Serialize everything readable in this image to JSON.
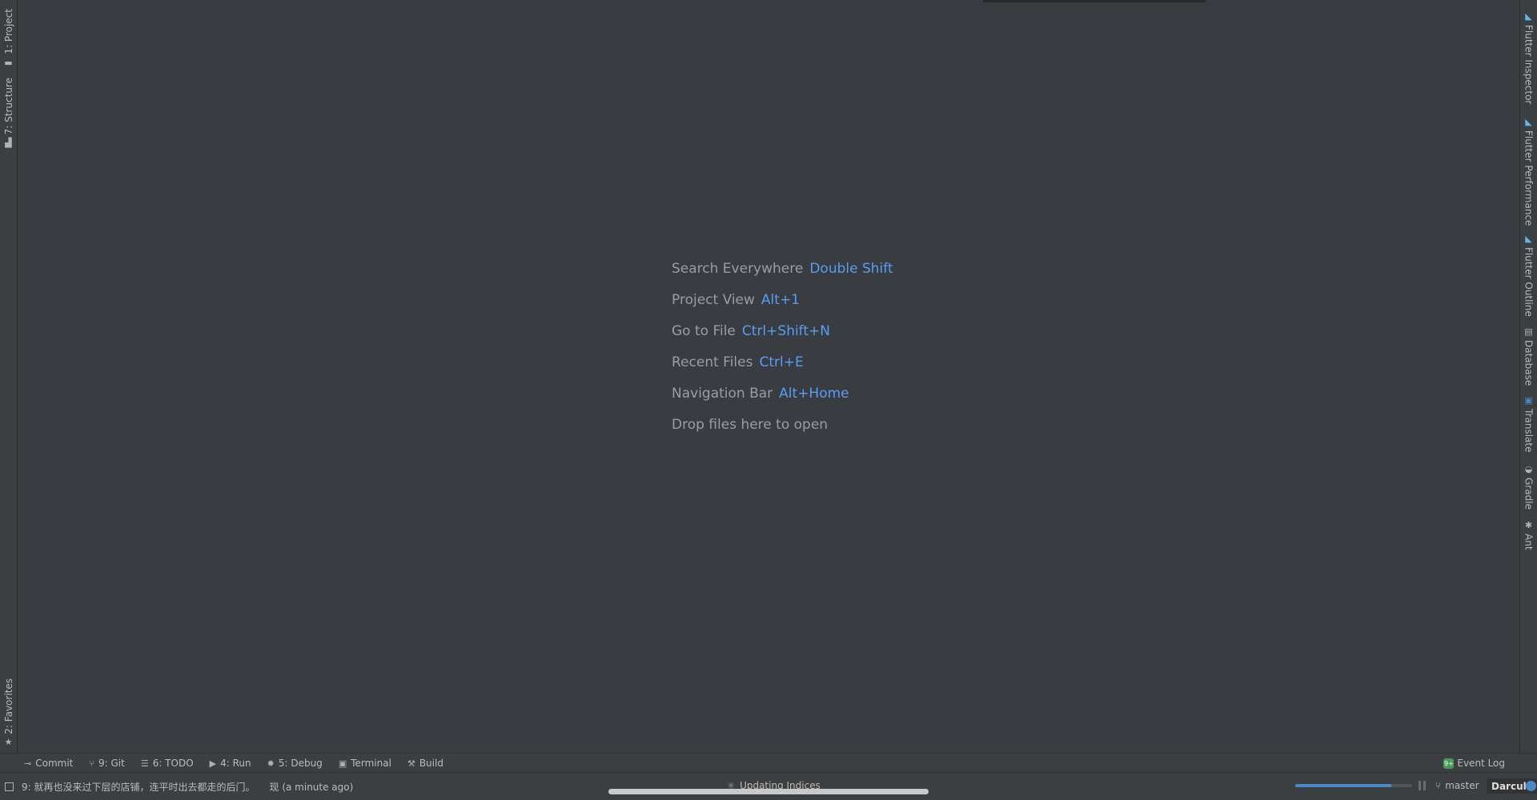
{
  "left_stripe": {
    "top_tabs": [
      {
        "label": "1: Project",
        "icon": "folder-icon"
      },
      {
        "label": "7: Structure",
        "icon": "structure-icon"
      }
    ],
    "bottom_tabs": [
      {
        "label": "2: Favorites",
        "icon": "star-icon"
      }
    ]
  },
  "right_stripe": {
    "tabs": [
      {
        "label": "Flutter Inspector",
        "icon": "flutter-icon"
      },
      {
        "label": "Flutter Performance",
        "icon": "flutter-icon"
      },
      {
        "label": "Flutter Outline",
        "icon": "flutter-icon"
      },
      {
        "label": "Database",
        "icon": "database-icon"
      },
      {
        "label": "Translate",
        "icon": "translate-icon"
      },
      {
        "label": "Gradle",
        "icon": "gradle-icon"
      },
      {
        "label": "Ant",
        "icon": "ant-icon"
      }
    ]
  },
  "editor": {
    "hints": [
      {
        "text": "Search Everywhere",
        "key": "Double Shift"
      },
      {
        "text": "Project View",
        "key": "Alt+1"
      },
      {
        "text": "Go to File",
        "key": "Ctrl+Shift+N"
      },
      {
        "text": "Recent Files",
        "key": "Ctrl+E"
      },
      {
        "text": "Navigation Bar",
        "key": "Alt+Home"
      },
      {
        "text": "Drop files here to open",
        "key": ""
      }
    ]
  },
  "toolbar": {
    "buttons": [
      {
        "label": "Commit",
        "icon": "commit-icon"
      },
      {
        "label": "9: Git",
        "icon": "git-branch-icon"
      },
      {
        "label": "6: TODO",
        "icon": "todo-list-icon"
      },
      {
        "label": "4: Run",
        "icon": "run-icon"
      },
      {
        "label": "5: Debug",
        "icon": "debug-icon"
      },
      {
        "label": "Terminal",
        "icon": "terminal-icon"
      },
      {
        "label": "Build",
        "icon": "build-hammer-icon"
      }
    ],
    "event_log": {
      "label": "Event Log",
      "badge": "9+"
    }
  },
  "status": {
    "message": "9: 就再也没来过下层的店铺，连平时出去都走的后门。",
    "time": "现 (a minute ago)",
    "task": "Updating Indices",
    "progress": 0.82,
    "branch": "master",
    "theme": "Darcula",
    "colors": {
      "accent": "#589df6",
      "progress": "#4a88c7"
    }
  }
}
